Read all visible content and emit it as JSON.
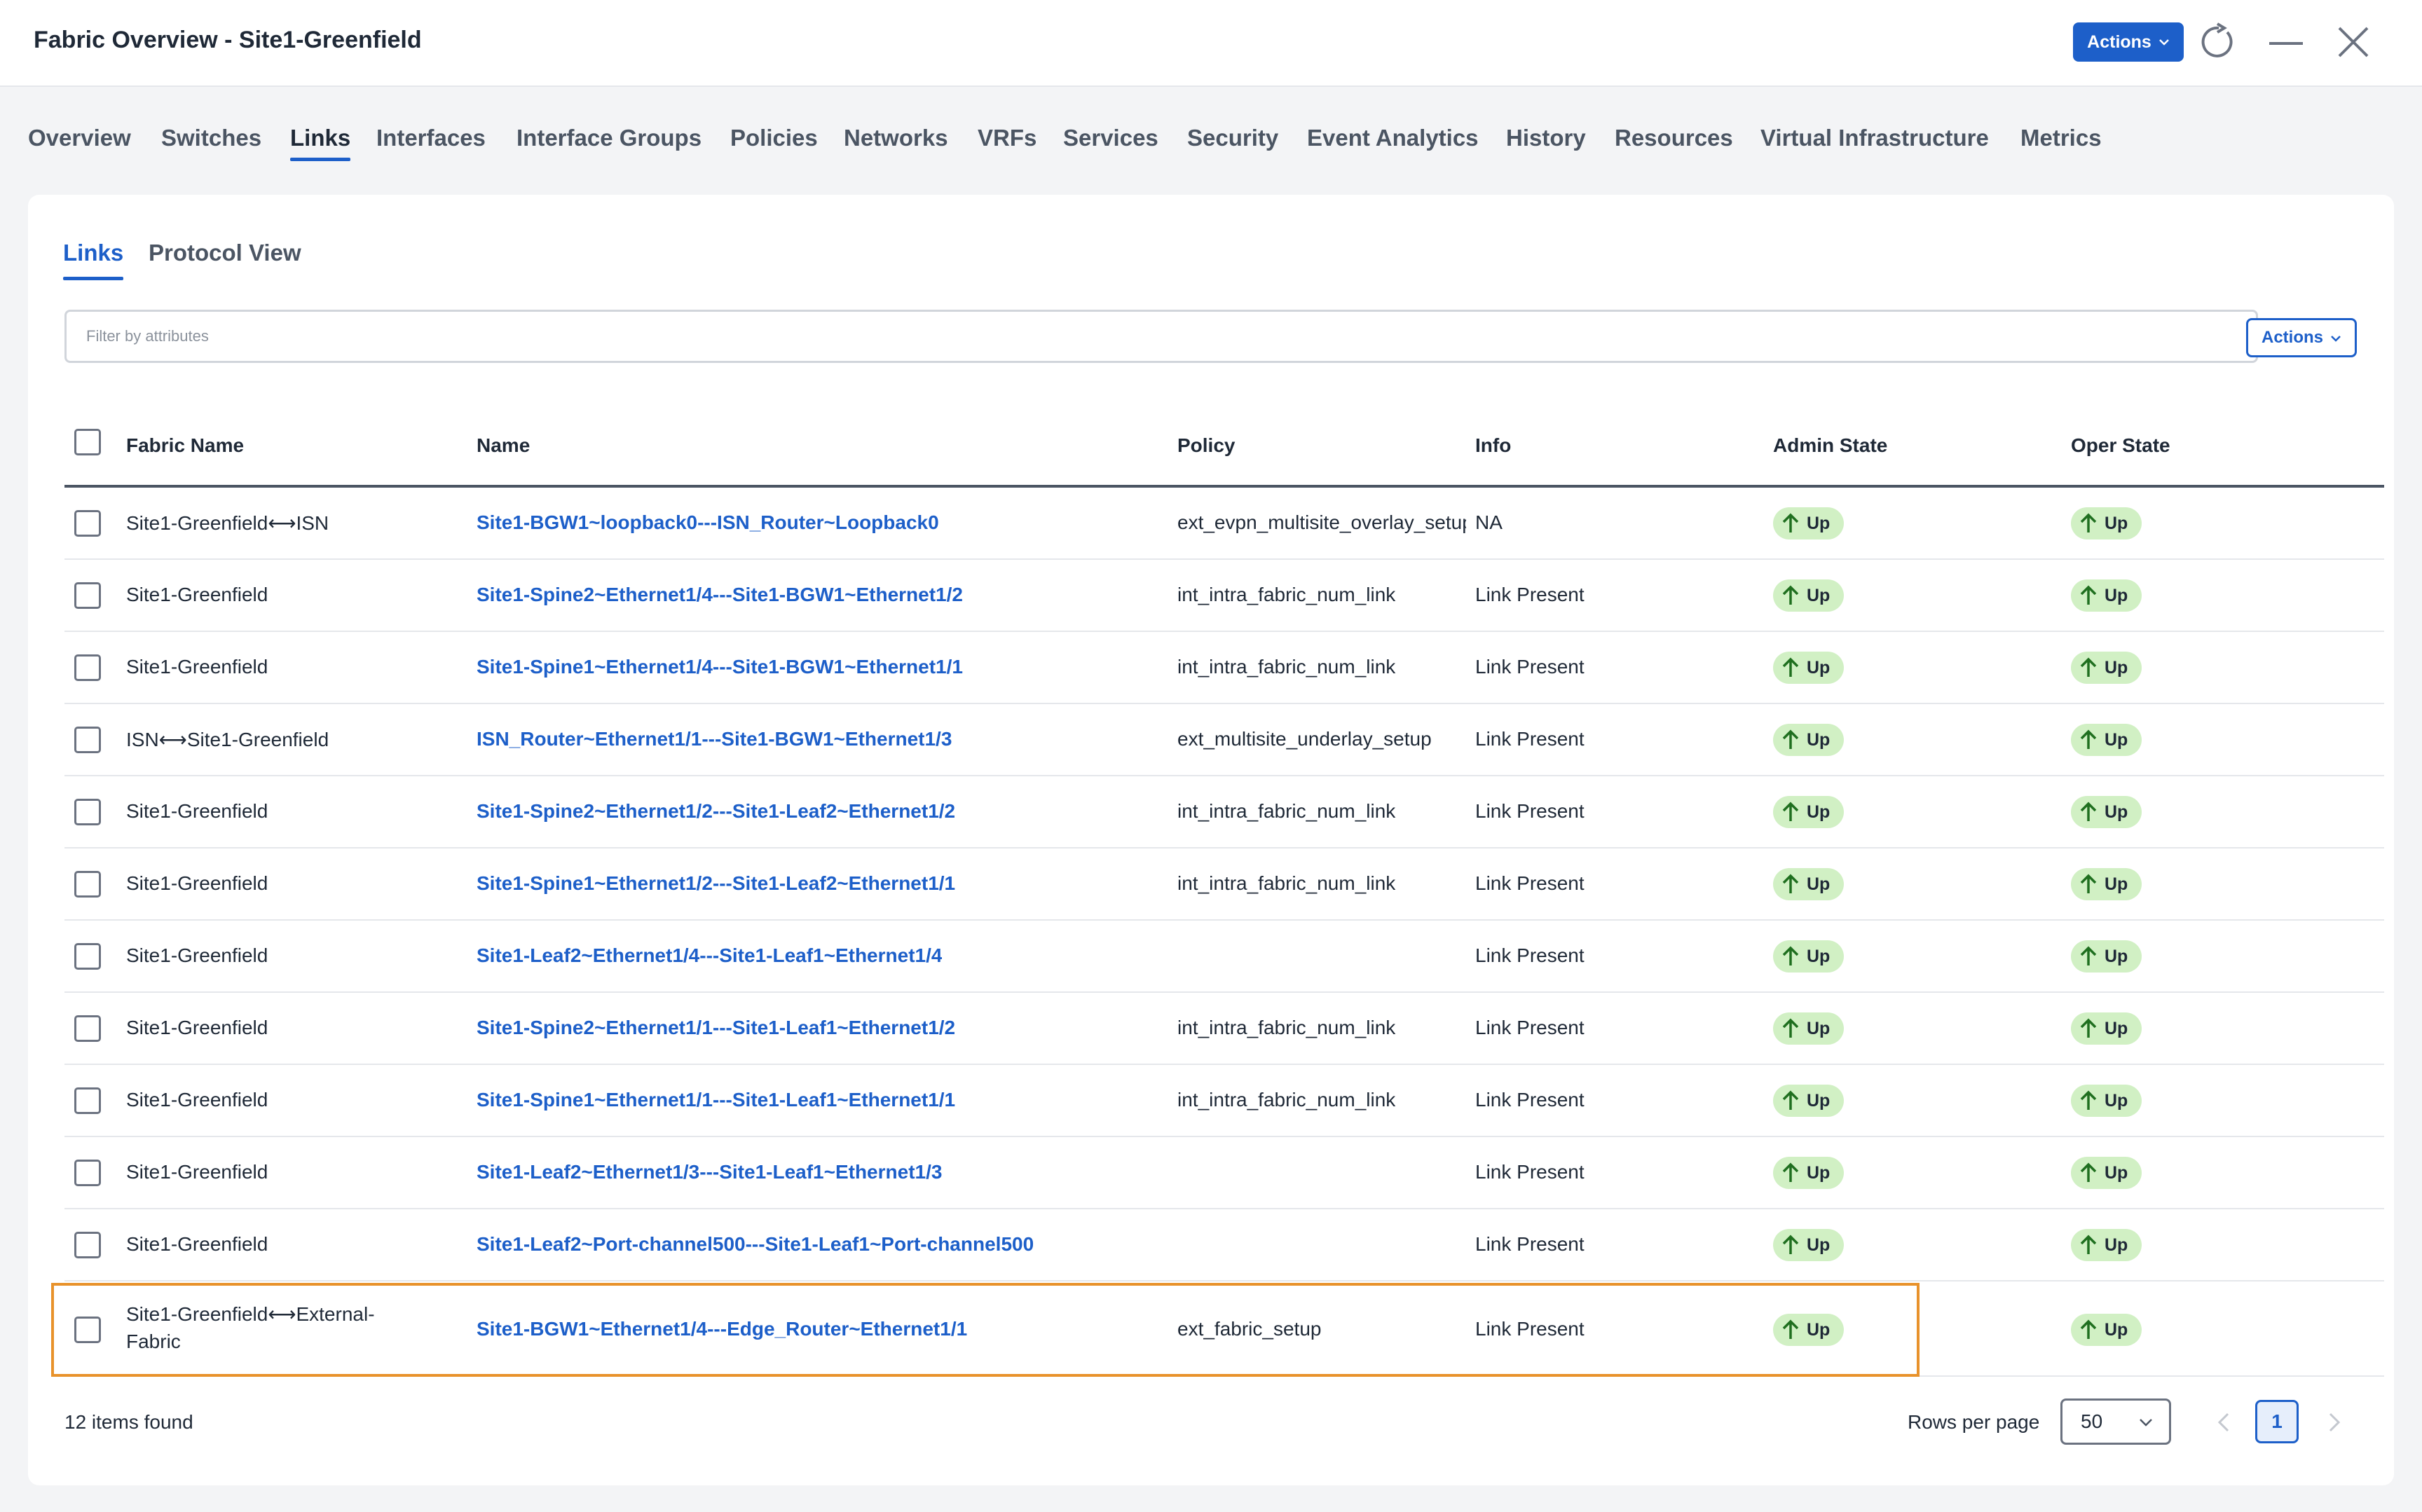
{
  "header": {
    "title": "Fabric Overview - Site1-Greenfield",
    "actions_label": "Actions"
  },
  "tabs": [
    "Overview",
    "Switches",
    "Links",
    "Interfaces",
    "Interface Groups",
    "Policies",
    "Networks",
    "VRFs",
    "Services",
    "Security",
    "Event Analytics",
    "History",
    "Resources",
    "Virtual Infrastructure",
    "Metrics"
  ],
  "active_tab": "Links",
  "subtabs": [
    "Links",
    "Protocol View"
  ],
  "filter": {
    "placeholder": "Filter by attributes"
  },
  "card_actions_label": "Actions",
  "table": {
    "columns": [
      "Fabric Name",
      "Name",
      "Policy",
      "Info",
      "Admin State",
      "Oper State"
    ],
    "rows": [
      {
        "fabric": "Site1-Greenfield⟷ISN",
        "name": "Site1-BGW1~loopback0---ISN_Router~Loopback0",
        "policy": "ext_evpn_multisite_overlay_setup",
        "info": "NA",
        "admin": "Up",
        "oper": "Up"
      },
      {
        "fabric": "Site1-Greenfield",
        "name": "Site1-Spine2~Ethernet1/4---Site1-BGW1~Ethernet1/2",
        "policy": "int_intra_fabric_num_link",
        "info": "Link Present",
        "admin": "Up",
        "oper": "Up"
      },
      {
        "fabric": "Site1-Greenfield",
        "name": "Site1-Spine1~Ethernet1/4---Site1-BGW1~Ethernet1/1",
        "policy": "int_intra_fabric_num_link",
        "info": "Link Present",
        "admin": "Up",
        "oper": "Up"
      },
      {
        "fabric": "ISN⟷Site1-Greenfield",
        "name": "ISN_Router~Ethernet1/1---Site1-BGW1~Ethernet1/3",
        "policy": "ext_multisite_underlay_setup",
        "info": "Link Present",
        "admin": "Up",
        "oper": "Up"
      },
      {
        "fabric": "Site1-Greenfield",
        "name": "Site1-Spine2~Ethernet1/2---Site1-Leaf2~Ethernet1/2",
        "policy": "int_intra_fabric_num_link",
        "info": "Link Present",
        "admin": "Up",
        "oper": "Up"
      },
      {
        "fabric": "Site1-Greenfield",
        "name": "Site1-Spine1~Ethernet1/2---Site1-Leaf2~Ethernet1/1",
        "policy": "int_intra_fabric_num_link",
        "info": "Link Present",
        "admin": "Up",
        "oper": "Up"
      },
      {
        "fabric": "Site1-Greenfield",
        "name": "Site1-Leaf2~Ethernet1/4---Site1-Leaf1~Ethernet1/4",
        "policy": "",
        "info": "Link Present",
        "admin": "Up",
        "oper": "Up"
      },
      {
        "fabric": "Site1-Greenfield",
        "name": "Site1-Spine2~Ethernet1/1---Site1-Leaf1~Ethernet1/2",
        "policy": "int_intra_fabric_num_link",
        "info": "Link Present",
        "admin": "Up",
        "oper": "Up"
      },
      {
        "fabric": "Site1-Greenfield",
        "name": "Site1-Spine1~Ethernet1/1---Site1-Leaf1~Ethernet1/1",
        "policy": "int_intra_fabric_num_link",
        "info": "Link Present",
        "admin": "Up",
        "oper": "Up"
      },
      {
        "fabric": "Site1-Greenfield",
        "name": "Site1-Leaf2~Ethernet1/3---Site1-Leaf1~Ethernet1/3",
        "policy": "",
        "info": "Link Present",
        "admin": "Up",
        "oper": "Up"
      },
      {
        "fabric": "Site1-Greenfield",
        "name": "Site1-Leaf2~Port-channel500---Site1-Leaf1~Port-channel500",
        "policy": "",
        "info": "Link Present",
        "admin": "Up",
        "oper": "Up"
      },
      {
        "fabric_line1": "Site1-Greenfield⟷External-",
        "fabric_line2": "Fabric",
        "name": "Site1-BGW1~Ethernet1/4---Edge_Router~Ethernet1/1",
        "policy": "ext_fabric_setup",
        "info": "Link Present",
        "admin": "Up",
        "oper": "Up",
        "highlighted": true
      }
    ]
  },
  "footer": {
    "items_found": "12 items found",
    "rows_per_page_label": "Rows per page",
    "rows_per_page_value": "50",
    "current_page": "1"
  },
  "colors": {
    "accent": "#1d5fc9",
    "badge_bg": "#d1f0c4",
    "badge_arrow": "#1f6f1f",
    "highlight": "#e8922b"
  },
  "icons": [
    "chevron-down-icon",
    "refresh-icon",
    "minimize-icon",
    "close-icon",
    "arrow-up-icon",
    "chevron-left-icon",
    "chevron-right-icon"
  ]
}
